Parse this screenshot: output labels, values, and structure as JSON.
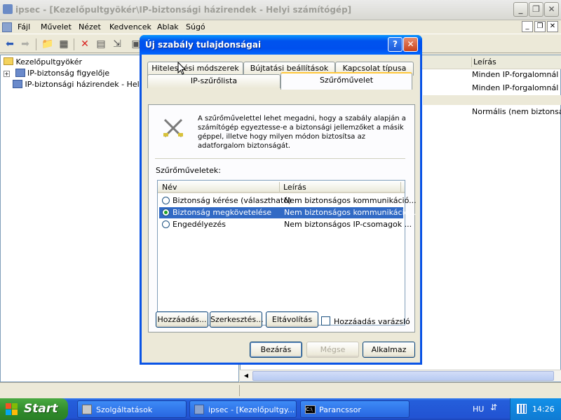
{
  "main_window": {
    "title": "ipsec - [Kezelőpultgyökér\\IP-biztonsági házirendek - Helyi számítógép]",
    "menu": [
      "Fájl",
      "Művelet",
      "Nézet",
      "Kedvencek",
      "Ablak",
      "Súgó"
    ],
    "tree": {
      "root": "Kezelőpultgyökér",
      "items": [
        "IP-biztonság figyelője",
        "IP-biztonsági házirendek - Helyi s"
      ]
    },
    "list": {
      "header_desc": "Leírás",
      "rows": [
        "Minden IP-forgalomnál min",
        "Minden IP-forgalomnál min",
        "Normális (nem biztonságos"
      ]
    }
  },
  "dialog": {
    "title": "Új szabály tulajdonságai",
    "tabs_back": [
      "Hitelesítési módszerek",
      "Bújtatási beállítások",
      "Kapcsolat típusa"
    ],
    "tabs_front": [
      "IP-szűrőlista",
      "Szűrőművelet"
    ],
    "active_tab": "Szűrőművelet",
    "description": "A szűrőművelettel lehet megadni, hogy a szabály alapján a számítógép egyeztesse-e a biztonsági jellemzőket a másik géppel, illetve hogy milyen módon biztosítsa az adatforgalom biztonságát.",
    "list_label": "Szűrőműveletek:",
    "columns": {
      "name": "Név",
      "description": "Leírás"
    },
    "actions": [
      {
        "name": "Biztonság kérése (választható)",
        "description": "Nem biztonságos kommunikáció...",
        "selected": false
      },
      {
        "name": "Biztonság megkövetelése",
        "description": "Nem biztonságos kommunikáció...",
        "selected": true
      },
      {
        "name": "Engedélyezés",
        "description": "Nem biztonságos IP-csomagok ...",
        "selected": false
      }
    ],
    "buttons": {
      "add": "Hozzáadás...",
      "edit": "Szerkesztés...",
      "remove": "Eltávolítás",
      "wizard": "Hozzáadás varázsló",
      "close": "Bezárás",
      "cancel": "Mégse",
      "apply": "Alkalmaz"
    },
    "wizard_checked": false
  },
  "taskbar": {
    "start": "Start",
    "tasks": [
      "Szolgáltatások",
      "ipsec - [Kezelőpultgy...",
      "Parancssor"
    ],
    "lang": "HU",
    "clock": "14:26"
  },
  "colors": {
    "titlebar_active": "#0054e3",
    "selection": "#316ac5",
    "taskbar": "#245edb",
    "start": "#3c9a35"
  }
}
